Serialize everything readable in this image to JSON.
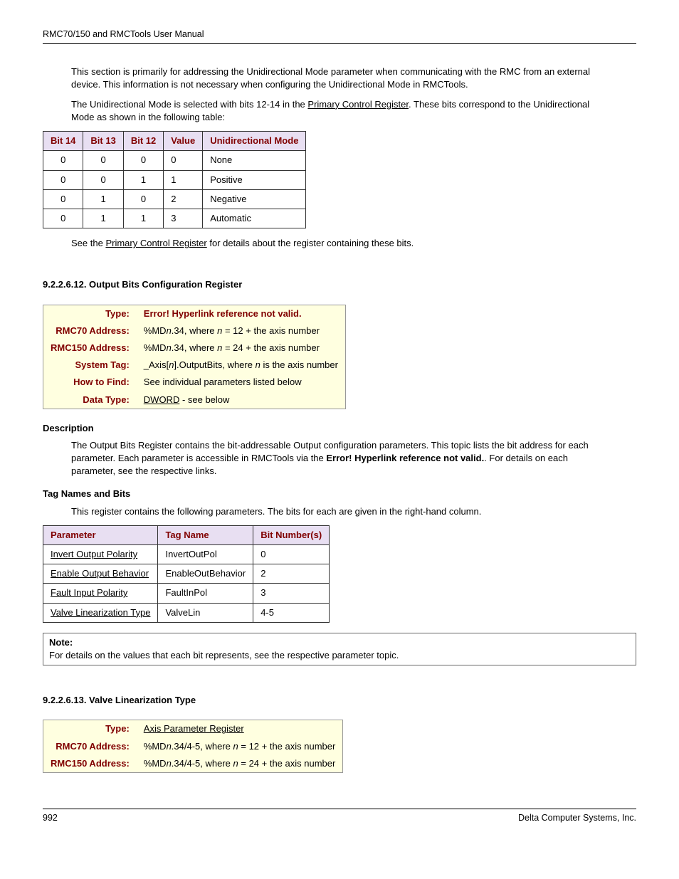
{
  "header": "RMC70/150 and RMCTools User Manual",
  "intro": {
    "p1": "This section is primarily for addressing the Unidirectional Mode parameter when communicating with the RMC from an external device. This information is not necessary when configuring the Unidirectional Mode in RMCTools.",
    "p2a": "The Unidirectional Mode is selected with bits 12-14 in the ",
    "p2link": "Primary Control Register",
    "p2b": ". These bits correspond to the Unidirectional Mode as shown in the following table:"
  },
  "table1": {
    "headers": [
      "Bit 14",
      "Bit 13",
      "Bit 12",
      "Value",
      "Unidirectional Mode"
    ],
    "rows": [
      [
        "0",
        "0",
        "0",
        "0",
        "None"
      ],
      [
        "0",
        "0",
        "1",
        "1",
        "Positive"
      ],
      [
        "0",
        "1",
        "0",
        "2",
        "Negative"
      ],
      [
        "0",
        "1",
        "1",
        "3",
        "Automatic"
      ]
    ]
  },
  "afterTable1a": "See the ",
  "afterTable1link": "Primary Control Register",
  "afterTable1b": " for details about the register containing these bits.",
  "sec12": {
    "heading": "9.2.2.6.12. Output Bits Configuration Register",
    "rows": {
      "type_label": "Type:",
      "type_val": "Error! Hyperlink reference not valid.",
      "rmc70_label": "RMC70 Address:",
      "rmc70_a": "%MD",
      "rmc70_n1": "n",
      "rmc70_b": ".34, where ",
      "rmc70_n2": "n",
      "rmc70_c": " = 12 + the axis number",
      "rmc150_label": "RMC150 Address:",
      "rmc150_a": "%MD",
      "rmc150_n1": "n",
      "rmc150_b": ".34, where ",
      "rmc150_n2": "n",
      "rmc150_c": " = 24 + the axis number",
      "tag_label": "System Tag:",
      "tag_a": "_Axis[",
      "tag_n1": "n",
      "tag_b": "].OutputBits, where ",
      "tag_n2": "n",
      "tag_c": " is the axis number",
      "how_label": "How to Find:",
      "how_val": "See individual parameters listed below",
      "dt_label": "Data Type:",
      "dt_link": "DWORD",
      "dt_after": " - see below"
    },
    "desc_head": "Description",
    "desc_a": "The Output Bits Register contains the bit-addressable Output configuration parameters. This topic lists the bit address for each parameter. Each parameter is accessible in RMCTools via the ",
    "desc_bold": "Error! Hyperlink reference not valid.",
    "desc_b": ". For details on each parameter, see the respective links.",
    "tags_head": "Tag Names and Bits",
    "tags_intro": "This register contains the following parameters. The bits for each are given in the right-hand column.",
    "tags_headers": [
      "Parameter",
      "Tag Name",
      "Bit Number(s)"
    ],
    "tags_rows": [
      [
        "Invert Output Polarity",
        "InvertOutPol",
        "0"
      ],
      [
        "Enable Output Behavior",
        "EnableOutBehavior",
        "2"
      ],
      [
        "Fault Input Polarity",
        "FaultInPol",
        "3"
      ],
      [
        "Valve Linearization Type",
        "ValveLin",
        "4-5"
      ]
    ],
    "note_label": "Note:",
    "note_text": "For details on the values that each bit represents, see the respective parameter topic."
  },
  "sec13": {
    "heading": "9.2.2.6.13. Valve Linearization Type",
    "type_label": "Type:",
    "type_link": "Axis Parameter Register",
    "rmc70_label": "RMC70 Address:",
    "rmc70_a": "%MD",
    "rmc70_n1": "n",
    "rmc70_b": ".34/4-5, where ",
    "rmc70_n2": "n",
    "rmc70_c": " = 12 + the axis number",
    "rmc150_label": "RMC150 Address:",
    "rmc150_a": "%MD",
    "rmc150_n1": "n",
    "rmc150_b": ".34/4-5, where ",
    "rmc150_n2": "n",
    "rmc150_c": " = 24 + the axis number"
  },
  "footer": {
    "page": "992",
    "company": "Delta Computer Systems, Inc."
  }
}
